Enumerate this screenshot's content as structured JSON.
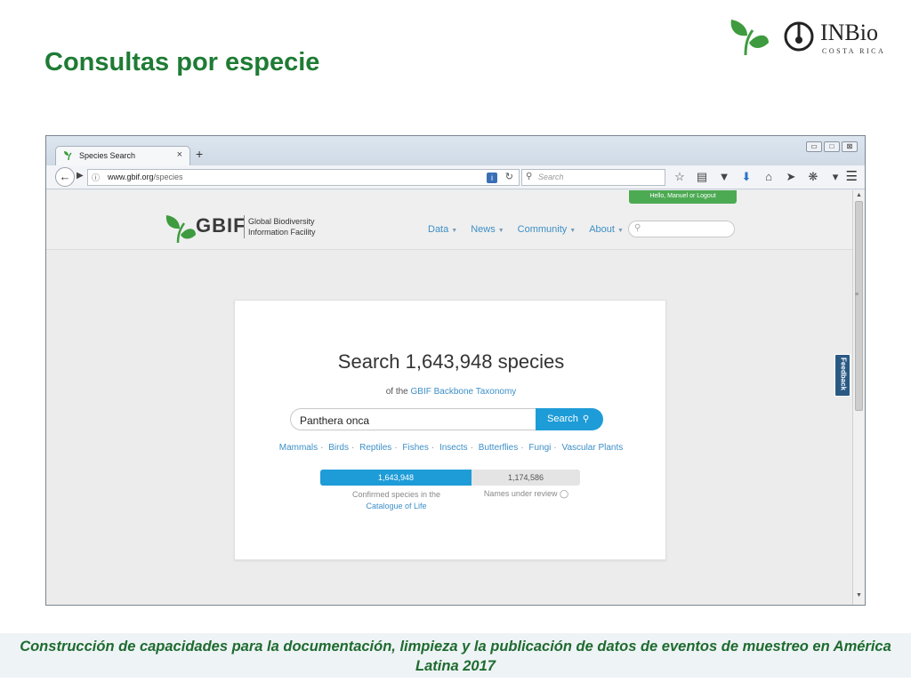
{
  "slide": {
    "title": "Consultas por especie",
    "footer": "Construcción de capacidades para la documentación, limpieza y la publicación de datos de eventos de muestreo en América Latina 2017",
    "logo_inbio": "INBio",
    "logo_inbio_sub": "COSTA RICA",
    "colors": {
      "title": "#1e7b34",
      "footer": "#1e6b2f"
    }
  },
  "browser": {
    "tab_label": "Species Search",
    "tab_close": "×",
    "new_tab": "+",
    "url_domain": "www.gbif.org",
    "url_path": "/species",
    "search_placeholder": "Search",
    "win_min": "▭",
    "win_max": "□",
    "win_close": "⊠"
  },
  "gbif": {
    "user_banner": "Hello, Manuel or Logout",
    "logo_word": "GBIF",
    "logo_sub": "Global Biodiversity Information Facility",
    "nav": [
      "Data",
      "News",
      "Community",
      "About"
    ],
    "feedback": "Feedback",
    "colors": {
      "accent": "#1e9cd8",
      "link": "#3d8fc7",
      "banner": "#4caa52"
    }
  },
  "card": {
    "title": "Search 1,643,948 species",
    "sub_prefix": "of the",
    "sub_link": "GBIF Backbone Taxonomy",
    "search_value": "Panthera onca",
    "search_button": "Search",
    "taxa": [
      "Mammals",
      "Birds",
      "Reptiles",
      "Fishes",
      "Insects",
      "Butterflies",
      "Fungi",
      "Vascular Plants"
    ],
    "confirmed_value": "1,643,948",
    "confirmed_count": 1643948,
    "review_value": "1,174,586",
    "review_count": 1174586,
    "confirmed_label": "Confirmed species in the",
    "confirmed_link": "Catalogue of Life",
    "review_label": "Names under review"
  }
}
